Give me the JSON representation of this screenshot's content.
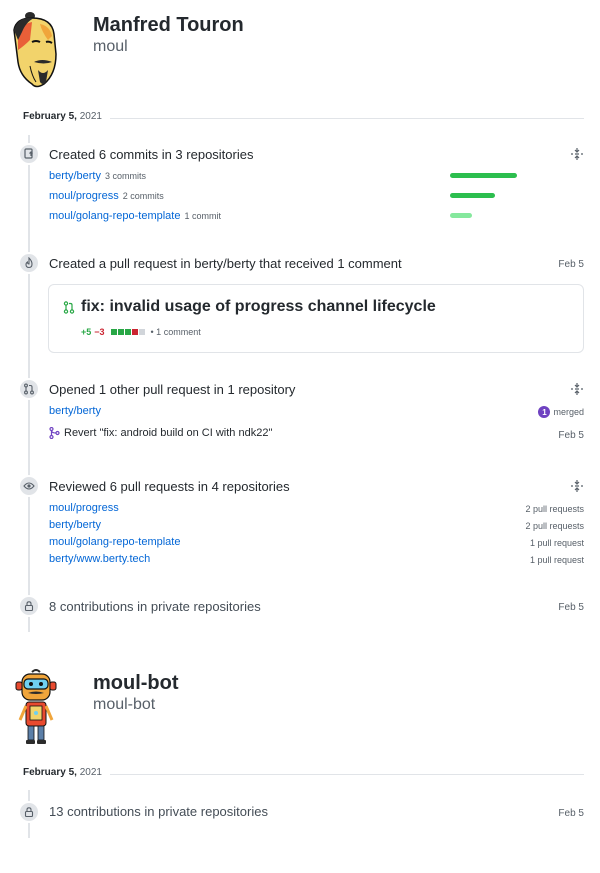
{
  "user1": {
    "name": "Manfred Touron",
    "login": "moul",
    "date": {
      "month_day": "February 5,",
      "year": "2021"
    },
    "commits_event": {
      "title": "Created 6 commits in 3 repositories",
      "repos": [
        {
          "name": "berty/berty",
          "count": "3 commits",
          "share": 1.0
        },
        {
          "name": "moul/progress",
          "count": "2 commits",
          "share": 0.67
        },
        {
          "name": "moul/golang-repo-template",
          "count": "1 commit",
          "share": 0.33
        }
      ]
    },
    "pr_event": {
      "title": "Created a pull request in berty/berty that received 1 comment",
      "date": "Feb 5",
      "card": {
        "title": "fix: invalid usage of progress channel lifecycle",
        "additions": "+5",
        "deletions": "−3",
        "comments": "• 1 comment"
      }
    },
    "opened_event": {
      "title": "Opened 1 other pull request in 1 repository",
      "repo": "berty/berty",
      "merged_count": "1",
      "merged_label": "merged",
      "pr_title": "Revert \"fix: android build on CI with ndk22\"",
      "pr_date": "Feb 5"
    },
    "reviewed_event": {
      "title": "Reviewed 6 pull requests in 4 repositories",
      "repos": [
        {
          "name": "moul/progress",
          "count": "2 pull requests"
        },
        {
          "name": "berty/berty",
          "count": "2 pull requests"
        },
        {
          "name": "moul/golang-repo-template",
          "count": "1 pull request"
        },
        {
          "name": "berty/www.berty.tech",
          "count": "1 pull request"
        }
      ]
    },
    "private_event": {
      "title": "8 contributions in private repositories",
      "date": "Feb 5"
    }
  },
  "user2": {
    "name": "moul-bot",
    "login": "moul-bot",
    "date": {
      "month_day": "February 5,",
      "year": "2021"
    },
    "private_event": {
      "title": "13 contributions in private repositories",
      "date": "Feb 5"
    }
  },
  "colors": {
    "link": "#0366d6",
    "bar_dark": "#2cbe4e",
    "bar_light": "#85e89d",
    "merged": "#6f42c1",
    "addition": "#28a745",
    "deletion": "#cb2431"
  }
}
